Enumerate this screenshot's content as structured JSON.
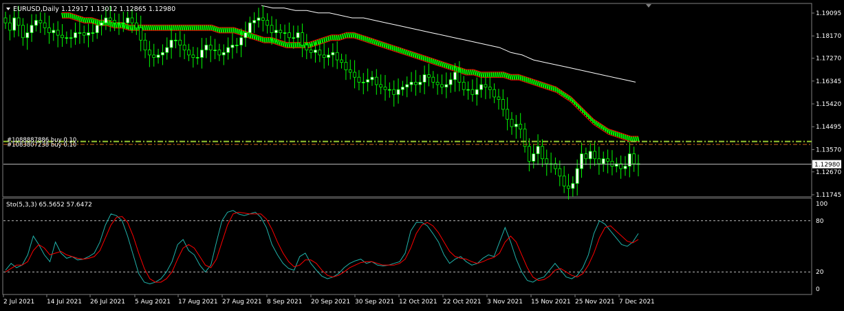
{
  "header": {
    "symbol_line": "EURUSD,Daily  1.12917 1.13012 1.12865 1.12980",
    "menu_arrow_icon": "triangle-down-icon"
  },
  "main_panel": {
    "price_labels": [
      "1.19095",
      "1.18170",
      "1.17270",
      "1.16345",
      "1.15420",
      "1.14495",
      "1.13570",
      "1.12670",
      "1.11745"
    ],
    "current_price_label": "1.12980",
    "level_label_1": "#1088887886 buy 0.10",
    "level_label_2": "#1083807238 buy 0.10"
  },
  "indicator_panel": {
    "title": "Sto(5,3,3) 65.5652 57.6472",
    "levels": [
      "100",
      "80",
      "20",
      "0"
    ]
  },
  "time_axis": {
    "labels": [
      "2 Jul 2021",
      "14 Jul 2021",
      "26 Jul 2021",
      "5 Aug 2021",
      "17 Aug 2021",
      "27 Aug 2021",
      "8 Sep 2021",
      "20 Sep 2021",
      "30 Sep 2021",
      "12 Oct 2021",
      "22 Oct 2021",
      "3 Nov 2021",
      "15 Nov 2021",
      "25 Nov 2021",
      "7 Dec 2021"
    ]
  },
  "colors": {
    "background": "#000000",
    "bull_candle": "#ffffff",
    "bear_candle": "#000000",
    "candle_wick": "#00ff00",
    "band_fill": "#00ff00",
    "band_edge": "#ff0000",
    "slow_ma": "#ffffff",
    "level_lime": "#9acd32",
    "level_orange": "#d2691e",
    "stoch_main": "#20b2aa",
    "stoch_signal": "#ff0000"
  },
  "chart_data": [
    {
      "type": "candlestick",
      "symbol": "EURUSD",
      "timeframe": "Daily",
      "ylim": [
        1.11745,
        1.19095
      ],
      "yticks": [
        1.19095,
        1.1817,
        1.1727,
        1.16345,
        1.1542,
        1.14495,
        1.1357,
        1.1267,
        1.11745
      ],
      "last_close": 1.1298,
      "level_lines": [
        1.139,
        1.1378
      ],
      "close_series": [
        1.187,
        1.184,
        1.189,
        1.186,
        1.181,
        1.183,
        1.186,
        1.188,
        1.187,
        1.185,
        1.183,
        1.184,
        1.182,
        1.181,
        1.181,
        1.181,
        1.183,
        1.183,
        1.182,
        1.183,
        1.183,
        1.186,
        1.187,
        1.189,
        1.188,
        1.187,
        1.187,
        1.187,
        1.189,
        1.187,
        1.185,
        1.18,
        1.176,
        1.174,
        1.173,
        1.174,
        1.175,
        1.177,
        1.18,
        1.18,
        1.178,
        1.176,
        1.174,
        1.173,
        1.173,
        1.176,
        1.178,
        1.176,
        1.176,
        1.174,
        1.175,
        1.177,
        1.178,
        1.178,
        1.181,
        1.183,
        1.187,
        1.188,
        1.189,
        1.188,
        1.186,
        1.183,
        1.184,
        1.183,
        1.183,
        1.181,
        1.181,
        1.183,
        1.178,
        1.176,
        1.175,
        1.176,
        1.174,
        1.173,
        1.174,
        1.175,
        1.172,
        1.171,
        1.168,
        1.167,
        1.165,
        1.163,
        1.163,
        1.164,
        1.165,
        1.162,
        1.161,
        1.16,
        1.16,
        1.158,
        1.16,
        1.161,
        1.162,
        1.163,
        1.162,
        1.163,
        1.166,
        1.165,
        1.163,
        1.162,
        1.161,
        1.162,
        1.164,
        1.167,
        1.163,
        1.16,
        1.16,
        1.158,
        1.16,
        1.162,
        1.161,
        1.16,
        1.157,
        1.156,
        1.152,
        1.148,
        1.145,
        1.146,
        1.144,
        1.137,
        1.131,
        1.134,
        1.137,
        1.132,
        1.13,
        1.13,
        1.128,
        1.125,
        1.121,
        1.12,
        1.122,
        1.128,
        1.134,
        1.132,
        1.135,
        1.132,
        1.13,
        1.132,
        1.131,
        1.129,
        1.13,
        1.128,
        1.129,
        1.134,
        1.13,
        1.1298
      ],
      "band_series": [
        1.19,
        1.19,
        1.189,
        1.188,
        1.188,
        1.187,
        1.187,
        1.186,
        1.186,
        1.185,
        1.185,
        1.185,
        1.185,
        1.185,
        1.185,
        1.185,
        1.185,
        1.185,
        1.185,
        1.185,
        1.185,
        1.184,
        1.184,
        1.184,
        1.183,
        1.182,
        1.181,
        1.18,
        1.18,
        1.179,
        1.178,
        1.178,
        1.178,
        1.178,
        1.179,
        1.18,
        1.181,
        1.181,
        1.182,
        1.182,
        1.181,
        1.18,
        1.179,
        1.178,
        1.177,
        1.176,
        1.175,
        1.174,
        1.173,
        1.172,
        1.171,
        1.17,
        1.169,
        1.168,
        1.167,
        1.167,
        1.166,
        1.166,
        1.166,
        1.166,
        1.165,
        1.165,
        1.164,
        1.163,
        1.162,
        1.161,
        1.16,
        1.158,
        1.156,
        1.153,
        1.15,
        1.147,
        1.145,
        1.143,
        1.142,
        1.141,
        1.14,
        1.14
      ],
      "slow_ma_series": [
        1.194,
        1.193,
        1.193,
        1.192,
        1.192,
        1.191,
        1.191,
        1.19,
        1.189,
        1.189,
        1.188,
        1.187,
        1.186,
        1.185,
        1.184,
        1.183,
        1.182,
        1.181,
        1.18,
        1.179,
        1.178,
        1.177,
        1.175,
        1.174,
        1.172,
        1.171,
        1.17,
        1.169,
        1.168,
        1.167,
        1.166,
        1.165,
        1.164,
        1.163
      ]
    },
    {
      "type": "line",
      "indicator": "Stochastic",
      "params": [
        5,
        3,
        3
      ],
      "ylim": [
        0,
        100
      ],
      "levels": [
        80,
        20
      ],
      "series": [
        {
          "name": "main",
          "values": [
            22,
            30,
            25,
            28,
            40,
            62,
            52,
            40,
            32,
            55,
            42,
            36,
            38,
            34,
            35,
            38,
            42,
            55,
            75,
            88,
            86,
            80,
            62,
            40,
            18,
            8,
            6,
            8,
            12,
            20,
            32,
            52,
            58,
            45,
            40,
            28,
            20,
            28,
            55,
            80,
            90,
            92,
            88,
            86,
            88,
            90,
            84,
            72,
            52,
            40,
            30,
            24,
            22,
            38,
            42,
            30,
            22,
            15,
            12,
            14,
            18,
            25,
            30,
            33,
            35,
            30,
            32,
            28,
            27,
            28,
            30,
            32,
            42,
            68,
            78,
            78,
            74,
            65,
            55,
            40,
            30,
            35,
            38,
            32,
            28,
            30,
            36,
            40,
            38,
            55,
            72,
            55,
            35,
            20,
            10,
            8,
            12,
            14,
            22,
            30,
            22,
            14,
            12,
            16,
            25,
            40,
            65,
            80,
            76,
            68,
            60,
            52,
            50,
            55,
            65
          ]
        },
        {
          "name": "signal",
          "values": [
            20,
            24,
            28,
            28,
            32,
            45,
            52,
            48,
            40,
            42,
            44,
            40,
            38,
            36,
            35,
            36,
            38,
            45,
            60,
            75,
            84,
            85,
            78,
            62,
            42,
            24,
            12,
            8,
            8,
            12,
            20,
            35,
            48,
            52,
            48,
            38,
            28,
            25,
            35,
            55,
            75,
            88,
            90,
            89,
            88,
            88,
            88,
            82,
            70,
            55,
            42,
            32,
            26,
            28,
            34,
            34,
            30,
            22,
            16,
            14,
            16,
            20,
            25,
            28,
            31,
            32,
            32,
            30,
            28,
            28,
            28,
            30,
            35,
            48,
            65,
            75,
            78,
            74,
            66,
            55,
            44,
            38,
            36,
            35,
            32,
            30,
            32,
            35,
            37,
            42,
            55,
            62,
            55,
            40,
            25,
            14,
            10,
            11,
            15,
            22,
            24,
            20,
            16,
            14,
            18,
            28,
            42,
            60,
            72,
            74,
            68,
            62,
            56,
            54,
            58
          ]
        }
      ]
    }
  ]
}
